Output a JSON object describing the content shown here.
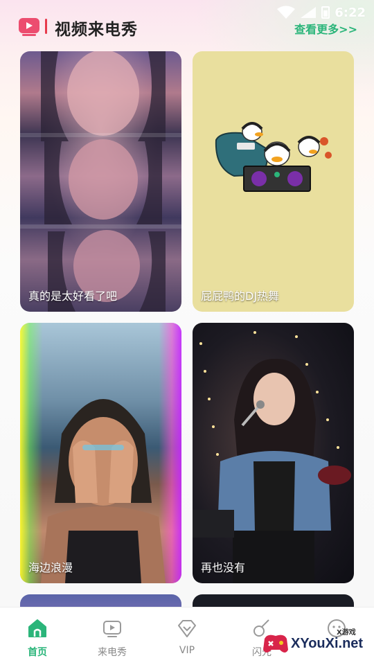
{
  "status_bar": {
    "time": "6:22"
  },
  "header": {
    "title": "视频来电秀",
    "more": "查看更多>>"
  },
  "cards": [
    {
      "label": "真的是太好看了吧"
    },
    {
      "label": "屁屁鸭的DJ热舞"
    },
    {
      "label": "海边浪漫"
    },
    {
      "label": "再也没有"
    }
  ],
  "bottom_nav": [
    {
      "label": "首页",
      "icon": "home-icon",
      "active": true
    },
    {
      "label": "来电秀",
      "icon": "tv-icon",
      "active": false
    },
    {
      "label": "VIP",
      "icon": "vip-diamond-icon",
      "active": false
    },
    {
      "label": "闪光",
      "icon": "flash-icon",
      "active": false
    },
    {
      "label": "",
      "icon": "smile-icon",
      "active": false
    }
  ],
  "watermark": {
    "text": "XYouXi.net",
    "small": "X游戏"
  },
  "colors": {
    "accent": "#2bb57a",
    "logo": "#e73a4c"
  }
}
